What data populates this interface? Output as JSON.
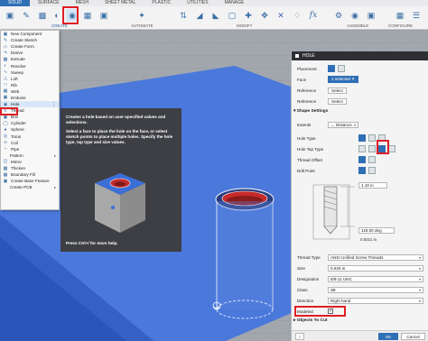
{
  "ribbon": {
    "tabs": [
      "SOLID",
      "SURFACE",
      "MESH",
      "SHEET METAL",
      "PLASTIC",
      "UTILITIES",
      "MANAGE"
    ],
    "groups": [
      "CREATE",
      "AUTOMATE",
      "MODIFY",
      "ASSEMBLE",
      "CONFIGURE"
    ]
  },
  "menu": {
    "items": [
      {
        "label": "New Component",
        "icon": "component-icon"
      },
      {
        "label": "Create Sketch",
        "icon": "sketch-icon"
      },
      {
        "label": "Create Form",
        "icon": "form-icon"
      },
      {
        "label": "Derive",
        "icon": "derive-icon"
      },
      {
        "label": "Extrude",
        "icon": "extrude-icon"
      },
      {
        "label": "Revolve",
        "icon": "revolve-icon"
      },
      {
        "label": "Sweep",
        "icon": "sweep-icon"
      },
      {
        "label": "Loft",
        "icon": "loft-icon"
      },
      {
        "label": "Rib",
        "icon": "rib-icon"
      },
      {
        "label": "Web",
        "icon": "web-icon"
      },
      {
        "label": "Emboss",
        "icon": "emboss-icon"
      },
      {
        "label": "Hole",
        "icon": "hole-icon"
      },
      {
        "label": "Thread",
        "icon": "thread-icon"
      },
      {
        "label": "Box",
        "icon": "box-icon"
      },
      {
        "label": "Cylinder",
        "icon": "cylinder-icon"
      },
      {
        "label": "Sphere",
        "icon": "sphere-icon"
      },
      {
        "label": "Torus",
        "icon": "torus-icon"
      },
      {
        "label": "Coil",
        "icon": "coil-icon"
      },
      {
        "label": "Pipe",
        "icon": "pipe-icon"
      },
      {
        "label": "Pattern",
        "icon": ""
      },
      {
        "label": "Mirror",
        "icon": "mirror-icon"
      },
      {
        "label": "Thicken",
        "icon": "thicken-icon"
      },
      {
        "label": "Boundary Fill",
        "icon": "boundary-fill-icon"
      },
      {
        "label": "Create Base Feature",
        "icon": "base-feature-icon"
      },
      {
        "label": "Create PCB",
        "icon": ""
      }
    ]
  },
  "tooltip": {
    "line1": "Creates a hole based on user-specified values and selections.",
    "line2": "Select a face to place the hole on the face, or select sketch points to place multiple holes. Specify the hole type, tap type and size values.",
    "hint": "Press Ctrl+/ for more help."
  },
  "panel": {
    "title": "HOLE",
    "placement_label": "Placement",
    "face_label": "Face",
    "face_value": "1 selected",
    "reference_label": "Reference",
    "select_label": "Select",
    "shape_settings_label": "Shape Settings",
    "extents_label": "Extents",
    "extents_value": "Distance",
    "hole_type_label": "Hole Type",
    "hole_tap_type_label": "Hole Tap Type",
    "thread_offset_label": "Thread Offset",
    "drill_point_label": "Drill Point",
    "dim_depth": "1.10 in",
    "dim_angle": "118.00 deg",
    "dim_dia": "0.5021 in",
    "thread_type_label": "Thread Type",
    "thread_type_value": "ANSI Unified Screw Threads",
    "size_label": "Size",
    "size_value": "0.625 in",
    "designation_label": "Designation",
    "designation_value": "5/8-11 UNC",
    "class_label": "Class",
    "class_value": "3B",
    "direction_label": "Direction",
    "direction_value": "Right hand",
    "modeled_label": "Modeled",
    "objects_to_cut_label": "Objects To Cut",
    "ok_label": "OK",
    "cancel_label": "Cancel"
  },
  "colors": {
    "accent": "#2f6fb5",
    "highlight_red": "#e01e24",
    "model_blue": "#3f6fd8"
  }
}
